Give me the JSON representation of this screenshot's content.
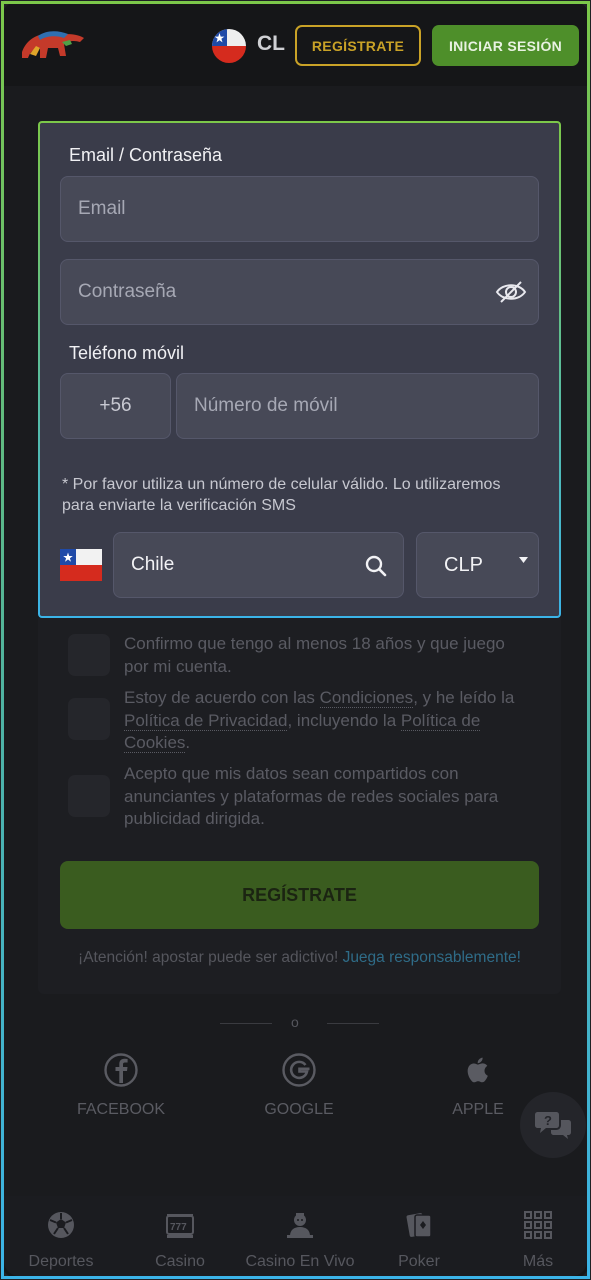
{
  "header": {
    "country_code": "CL",
    "register_label": "REGÍSTRATE",
    "login_label": "INICIAR SESIÓN"
  },
  "form": {
    "email_section_label": "Email / Contraseña",
    "email_placeholder": "Email",
    "password_placeholder": "Contraseña",
    "phone_section_label": "Teléfono móvil",
    "phone_prefix": "+56",
    "phone_placeholder": "Número de móvil",
    "phone_note": "* Por favor utiliza un número de celular válido. Lo utilizaremos para enviarte la verificación SMS",
    "country_value": "Chile",
    "currency_value": "CLP"
  },
  "consents": {
    "age_text": "Confirmo que tengo al menos 18 años y que juego por mi cuenta.",
    "terms_prefix": "Estoy de acuerdo con las ",
    "terms_link": "Condiciones",
    "terms_mid": ", y he leído la ",
    "privacy_link": "Política de Privacidad",
    "terms_mid2": ", incluyendo la ",
    "cookies_link": "Política de Cookies",
    "terms_end": ".",
    "data_share_text": "Acepto que mis datos sean compartidos con anunciantes y plataformas de redes sociales para publicidad dirigida."
  },
  "register_button": "REGÍSTRATE",
  "warning": {
    "text": "¡Atención! apostar puede ser adictivo! ",
    "link": "Juega responsablemente!"
  },
  "or_label": "o",
  "social": {
    "facebook": "FACEBOOK",
    "google": "GOOGLE",
    "apple": "APPLE"
  },
  "nav": {
    "items": [
      {
        "label": "Deportes",
        "icon": "soccer-ball-icon"
      },
      {
        "label": "Casino",
        "icon": "slot-machine-icon"
      },
      {
        "label": "Casino En Vivo",
        "icon": "live-dealer-icon"
      },
      {
        "label": "Poker",
        "icon": "cards-icon"
      },
      {
        "label": "Más",
        "icon": "grid-icon"
      }
    ]
  },
  "colors": {
    "accent_green": "#4e8f2a",
    "gold": "#c9a227",
    "link_blue": "#2f6c88"
  }
}
